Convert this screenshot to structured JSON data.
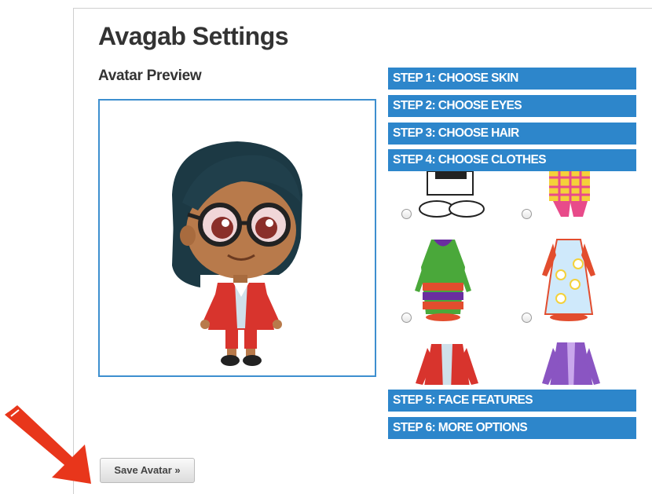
{
  "page": {
    "title": "Avagab Settings",
    "preview_label": "Avatar Preview"
  },
  "steps": [
    {
      "label": "STEP 1: CHOOSE SKIN"
    },
    {
      "label": "STEP 2: CHOOSE EYES"
    },
    {
      "label": "STEP 3: CHOOSE HAIR"
    },
    {
      "label": "STEP 4: CHOOSE CLOTHES"
    },
    {
      "label": "STEP 5: FACE FEATURES"
    },
    {
      "label": "STEP 6: MORE OPTIONS"
    }
  ],
  "clothes_options": [
    {
      "name": "white-pants-shoes"
    },
    {
      "name": "plaid-outfit"
    },
    {
      "name": "striped-robe"
    },
    {
      "name": "flower-dress"
    },
    {
      "name": "red-jacket"
    },
    {
      "name": "purple-jacket"
    }
  ],
  "save_button": {
    "label": "Save Avatar »"
  },
  "colors": {
    "accent": "#2d86cb",
    "arrow": "#e8361b"
  }
}
